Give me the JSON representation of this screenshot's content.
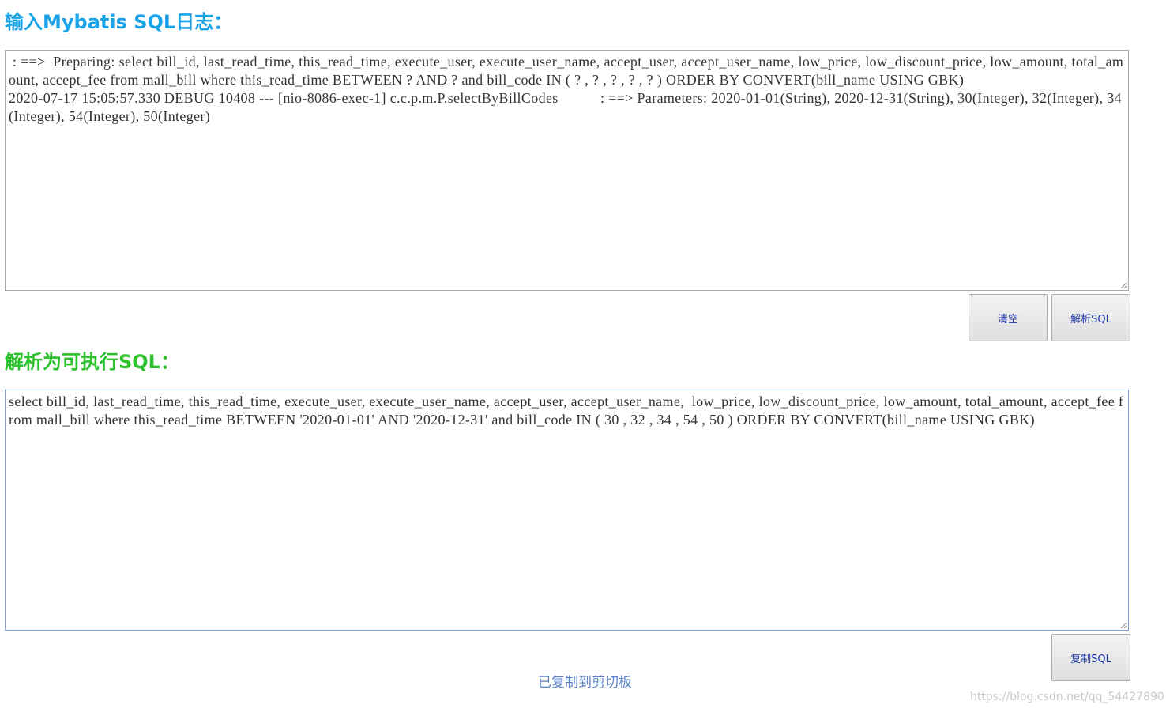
{
  "input_section": {
    "title": "输入Mybatis SQL日志：",
    "log_text": " : ==>  Preparing: select bill_id, last_read_time, this_read_time, execute_user, execute_user_name, accept_user, accept_user_name, low_price, low_discount_price, low_amount, total_amount, accept_fee from mall_bill where this_read_time BETWEEN ? AND ? and bill_code IN ( ? , ? , ? , ? , ? ) ORDER BY CONVERT(bill_name USING GBK)\n2020-07-17 15:05:57.330 DEBUG 10408 --- [nio-8086-exec-1] c.c.p.m.P.selectByBillCodes           : ==> Parameters: 2020-01-01(String), 2020-12-31(String), 30(Integer), 32(Integer), 34(Integer), 54(Integer), 50(Integer)"
  },
  "actions": {
    "clear_label": "清空",
    "parse_label": "解析SQL",
    "copy_label": "复制SQL"
  },
  "output_section": {
    "title": "解析为可执行SQL：",
    "sql_text": "select bill_id, last_read_time, this_read_time, execute_user, execute_user_name, accept_user, accept_user_name,  low_price, low_discount_price, low_amount, total_amount, accept_fee from mall_bill where this_read_time BETWEEN '2020-01-01' AND '2020-12-31' and bill_code IN ( 30 , 32 , 34 , 54 , 50 ) ORDER BY CONVERT(bill_name USING GBK)"
  },
  "status": {
    "copied_message": "已复制到剪切板"
  },
  "watermark": "https://blog.csdn.net/qq_54427890",
  "colors": {
    "input_title": "#1aa3e8",
    "output_title": "#2cc12c",
    "copied_message": "#5b82c8",
    "button_text": "#1a35a8"
  }
}
